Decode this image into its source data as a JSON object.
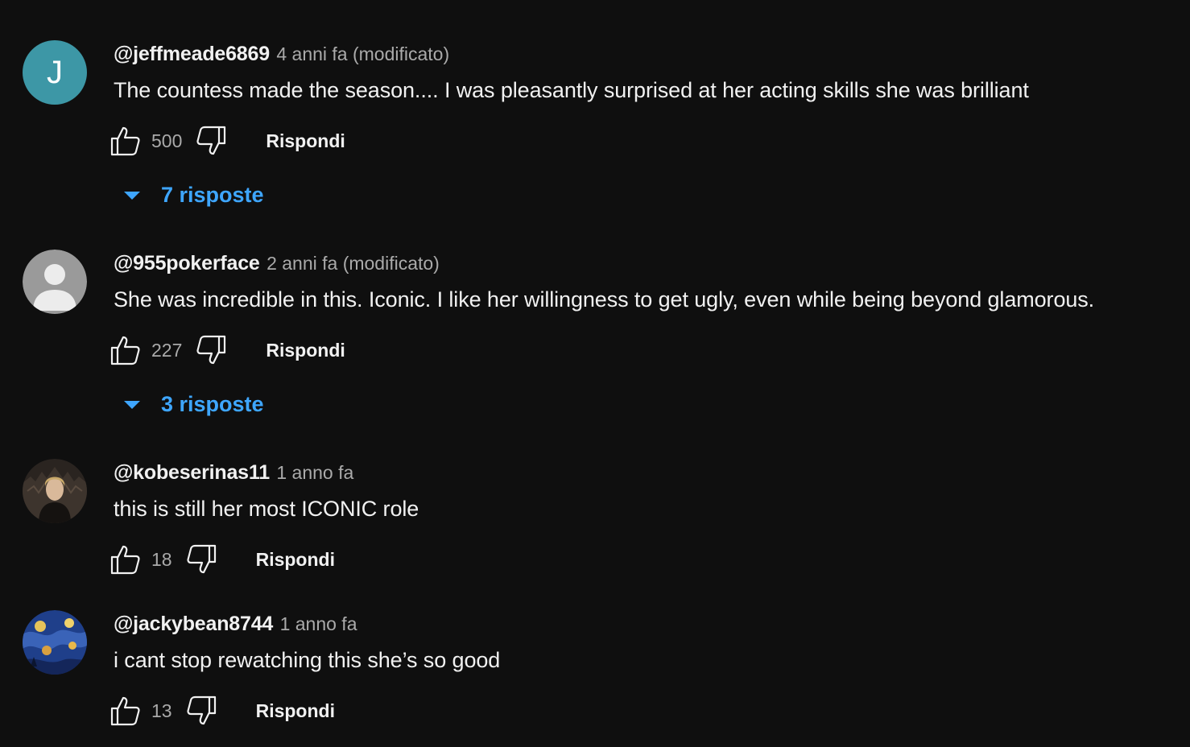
{
  "comments": [
    {
      "avatar_letter": "J",
      "author": "@jeffmeade6869",
      "time": "4 anni fa (modificato)",
      "text": "The countess made the season.... I was pleasantly surprised at her acting skills she was brilliant",
      "likes": "500",
      "reply_label": "Rispondi",
      "replies_label": "7 risposte"
    },
    {
      "author": "@955pokerface",
      "time": "2 anni fa (modificato)",
      "text": "She was incredible in this. Iconic. I like her willingness to get ugly, even while being beyond glamorous.",
      "likes": "227",
      "reply_label": "Rispondi",
      "replies_label": "3 risposte"
    },
    {
      "author": "@kobeserinas11",
      "time": "1 anno fa",
      "text": "this is still her most ICONIC role",
      "likes": "18",
      "reply_label": "Rispondi"
    },
    {
      "author": "@jackybean8744",
      "time": "1 anno fa",
      "text": "i cant stop rewatching this she’s so good",
      "likes": "13",
      "reply_label": "Rispondi"
    }
  ],
  "colors": {
    "background": "#0f0f0f",
    "text": "#f1f1f1",
    "secondary": "#aaaaaa",
    "link": "#3ea6ff",
    "avatar_j": "#3d97a6"
  },
  "icons": {
    "like": "thumb-up-icon",
    "dislike": "thumb-down-icon",
    "expand": "caret-down-icon"
  }
}
